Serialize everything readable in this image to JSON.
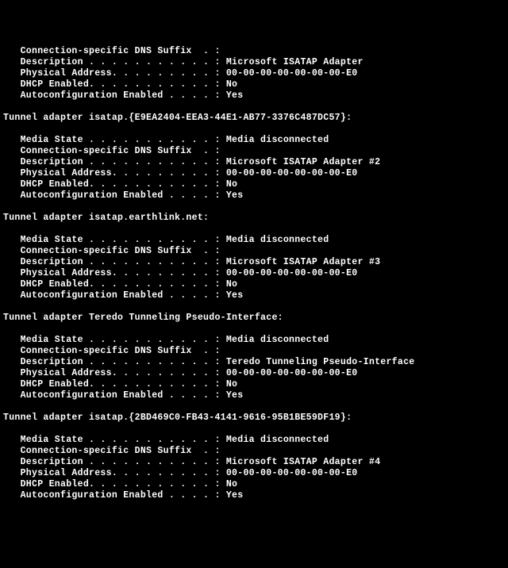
{
  "sections": [
    {
      "header": null,
      "fields": [
        {
          "label": "   Connection-specific DNS Suffix  . :",
          "value": ""
        },
        {
          "label": "   Description . . . . . . . . . . . :",
          "value": " Microsoft ISATAP Adapter"
        },
        {
          "label": "   Physical Address. . . . . . . . . :",
          "value": " 00-00-00-00-00-00-00-E0"
        },
        {
          "label": "   DHCP Enabled. . . . . . . . . . . :",
          "value": " No"
        },
        {
          "label": "   Autoconfiguration Enabled . . . . :",
          "value": " Yes"
        }
      ]
    },
    {
      "header": "Tunnel adapter isatap.{E9EA2404-EEA3-44E1-AB77-3376C487DC57}:",
      "fields": [
        {
          "label": "   Media State . . . . . . . . . . . :",
          "value": " Media disconnected"
        },
        {
          "label": "   Connection-specific DNS Suffix  . :",
          "value": ""
        },
        {
          "label": "   Description . . . . . . . . . . . :",
          "value": " Microsoft ISATAP Adapter #2"
        },
        {
          "label": "   Physical Address. . . . . . . . . :",
          "value": " 00-00-00-00-00-00-00-E0"
        },
        {
          "label": "   DHCP Enabled. . . . . . . . . . . :",
          "value": " No"
        },
        {
          "label": "   Autoconfiguration Enabled . . . . :",
          "value": " Yes"
        }
      ]
    },
    {
      "header": "Tunnel adapter isatap.earthlink.net:",
      "fields": [
        {
          "label": "   Media State . . . . . . . . . . . :",
          "value": " Media disconnected"
        },
        {
          "label": "   Connection-specific DNS Suffix  . :",
          "value": ""
        },
        {
          "label": "   Description . . . . . . . . . . . :",
          "value": " Microsoft ISATAP Adapter #3"
        },
        {
          "label": "   Physical Address. . . . . . . . . :",
          "value": " 00-00-00-00-00-00-00-E0"
        },
        {
          "label": "   DHCP Enabled. . . . . . . . . . . :",
          "value": " No"
        },
        {
          "label": "   Autoconfiguration Enabled . . . . :",
          "value": " Yes"
        }
      ]
    },
    {
      "header": "Tunnel adapter Teredo Tunneling Pseudo-Interface:",
      "fields": [
        {
          "label": "   Media State . . . . . . . . . . . :",
          "value": " Media disconnected"
        },
        {
          "label": "   Connection-specific DNS Suffix  . :",
          "value": ""
        },
        {
          "label": "   Description . . . . . . . . . . . :",
          "value": " Teredo Tunneling Pseudo-Interface"
        },
        {
          "label": "   Physical Address. . . . . . . . . :",
          "value": " 00-00-00-00-00-00-00-E0"
        },
        {
          "label": "   DHCP Enabled. . . . . . . . . . . :",
          "value": " No"
        },
        {
          "label": "   Autoconfiguration Enabled . . . . :",
          "value": " Yes"
        }
      ]
    },
    {
      "header": "Tunnel adapter isatap.{2BD469C0-FB43-4141-9616-95B1BE59DF19}:",
      "fields": [
        {
          "label": "   Media State . . . . . . . . . . . :",
          "value": " Media disconnected"
        },
        {
          "label": "   Connection-specific DNS Suffix  . :",
          "value": ""
        },
        {
          "label": "   Description . . . . . . . . . . . :",
          "value": " Microsoft ISATAP Adapter #4"
        },
        {
          "label": "   Physical Address. . . . . . . . . :",
          "value": " 00-00-00-00-00-00-00-E0"
        },
        {
          "label": "   DHCP Enabled. . . . . . . . . . . :",
          "value": " No"
        },
        {
          "label": "   Autoconfiguration Enabled . . . . :",
          "value": " Yes"
        }
      ]
    }
  ]
}
